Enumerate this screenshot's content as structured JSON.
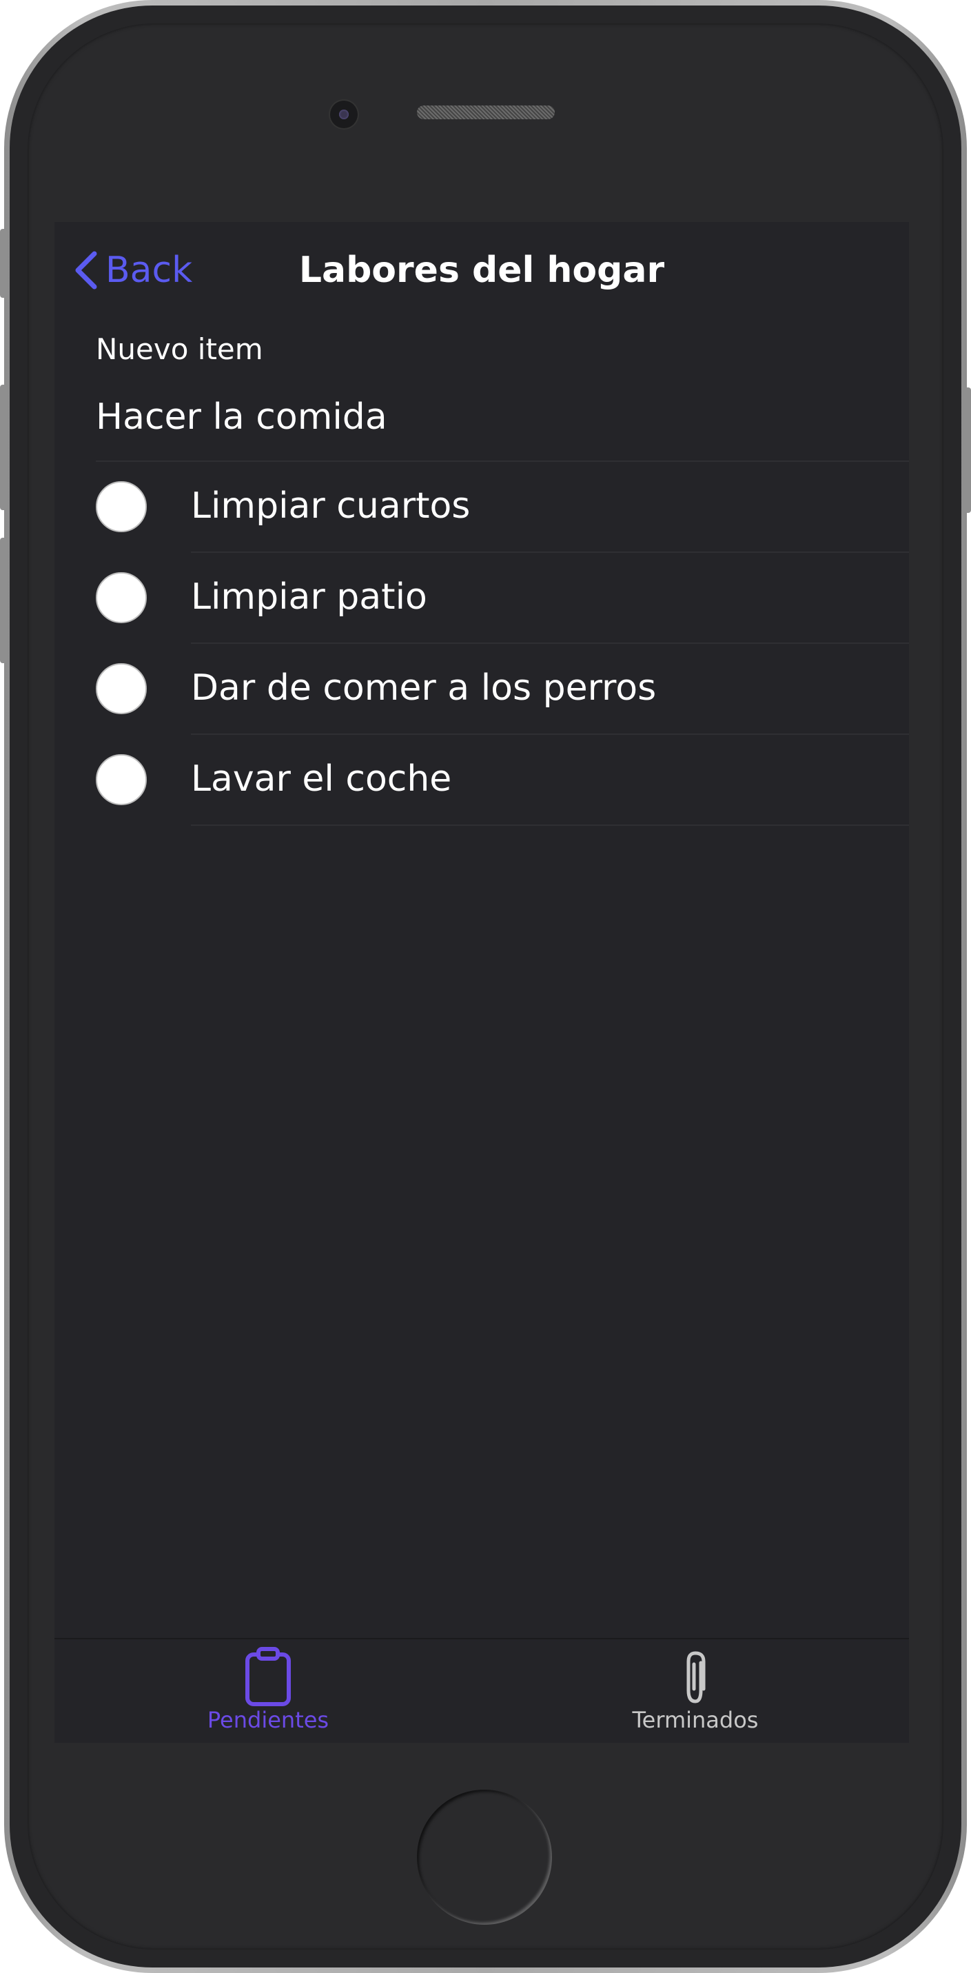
{
  "colors": {
    "accent": "#5b5bf0",
    "tab_active": "#6b4ae6",
    "tab_inactive": "#c8c8c8",
    "background": "#242428",
    "text": "#ffffff"
  },
  "nav": {
    "back_label": "Back",
    "title": "Labores del hogar"
  },
  "new_item": {
    "label": "Nuevo item",
    "value": "Hacer la comida"
  },
  "tasks": [
    {
      "label": "Limpiar cuartos",
      "done": false
    },
    {
      "label": "Limpiar patio",
      "done": false
    },
    {
      "label": "Dar de comer a los perros",
      "done": false
    },
    {
      "label": "Lavar el coche",
      "done": false
    }
  ],
  "tabs": [
    {
      "label": "Pendientes",
      "icon": "clipboard-icon",
      "active": true
    },
    {
      "label": "Terminados",
      "icon": "paperclip-icon",
      "active": false
    }
  ]
}
